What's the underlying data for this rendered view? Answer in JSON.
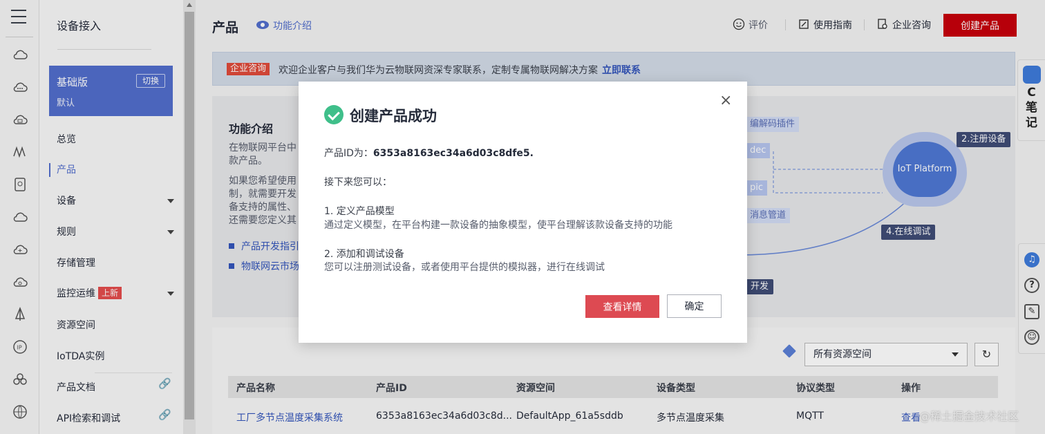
{
  "nav": {
    "title": "设备接入",
    "edition": {
      "name": "基础版",
      "switch_label": "切换",
      "sub": "默认"
    },
    "items": [
      {
        "label": "总览"
      },
      {
        "label": "产品"
      },
      {
        "label": "设备"
      },
      {
        "label": "规则"
      },
      {
        "label": "存储管理"
      },
      {
        "label": "监控运维",
        "badge": "上新"
      },
      {
        "label": "资源空间"
      },
      {
        "label": "IoTDA实例"
      },
      {
        "label": "产品文档"
      },
      {
        "label": "API检索和调试"
      }
    ]
  },
  "header": {
    "title": "产品",
    "feature_link": "功能介绍",
    "actions": {
      "rate": "评价",
      "guide": "使用指南",
      "consult": "企业咨询"
    },
    "create_button": "创建产品"
  },
  "banner": {
    "tag": "企业咨询",
    "text": "欢迎企业客户与我们华为云物联网资深专家联系，定制专属物联网解决方案",
    "link": "立即联系"
  },
  "intro": {
    "heading": "功能介绍",
    "para1_line1": "在物联网平台中",
    "para1_line2": "款产品。",
    "para2_line1": "如果您希望使用",
    "para2_line2": "制，就需要开发",
    "para2_line3": "备支持的属性、",
    "para2_line4": "还需要您定义其",
    "link1": "产品开发指引",
    "link2": "物联网云市场",
    "diagram": {
      "platform": "IoT Platform",
      "step2": "2.注册设备",
      "step4": "4.在线调试",
      "chip_codec_plugin": "编解码插件",
      "chip_codec": "dec",
      "chip_topic": "pic",
      "chip_msg": "消息管道",
      "chip_dev": "开发"
    }
  },
  "table": {
    "workspace_select": "所有资源空间",
    "columns": [
      "产品名称",
      "产品ID",
      "资源空间",
      "设备类型",
      "协议类型",
      "操作"
    ],
    "rows": [
      {
        "name": "工厂多节点温度采集系统",
        "id": "6353a8163ec34a6d03c8d...",
        "space": "DefaultApp_61a5sddb",
        "device_type": "多节点温度采集",
        "protocol": "MQTT",
        "action": "查看"
      }
    ]
  },
  "float_note": {
    "label_c": "C",
    "label_1": "笔",
    "label_2": "记"
  },
  "modal": {
    "title": "创建产品成功",
    "pid_label": "产品ID为：",
    "pid_value": "6353a8163ec34a6d03c8dfe5.",
    "next_label": "接下来您可以：",
    "step1_title": "1. 定义产品模型",
    "step1_desc": "通过定义模型，在平台构建一款设备的抽象模型，使平台理解该款设备支持的功能",
    "step2_title": "2. 添加和调试设备",
    "step2_desc": "您可以注册测试设备，或者使用平台提供的模拟器，进行在线调试",
    "primary_button": "查看详情",
    "secondary_button": "确定"
  },
  "watermark": "@稀土掘金技术社区",
  "colors": {
    "accent": "#526ecc",
    "brand_red": "#c7000b",
    "success": "#3fbf8a",
    "primary_btn": "#dd4a52"
  }
}
